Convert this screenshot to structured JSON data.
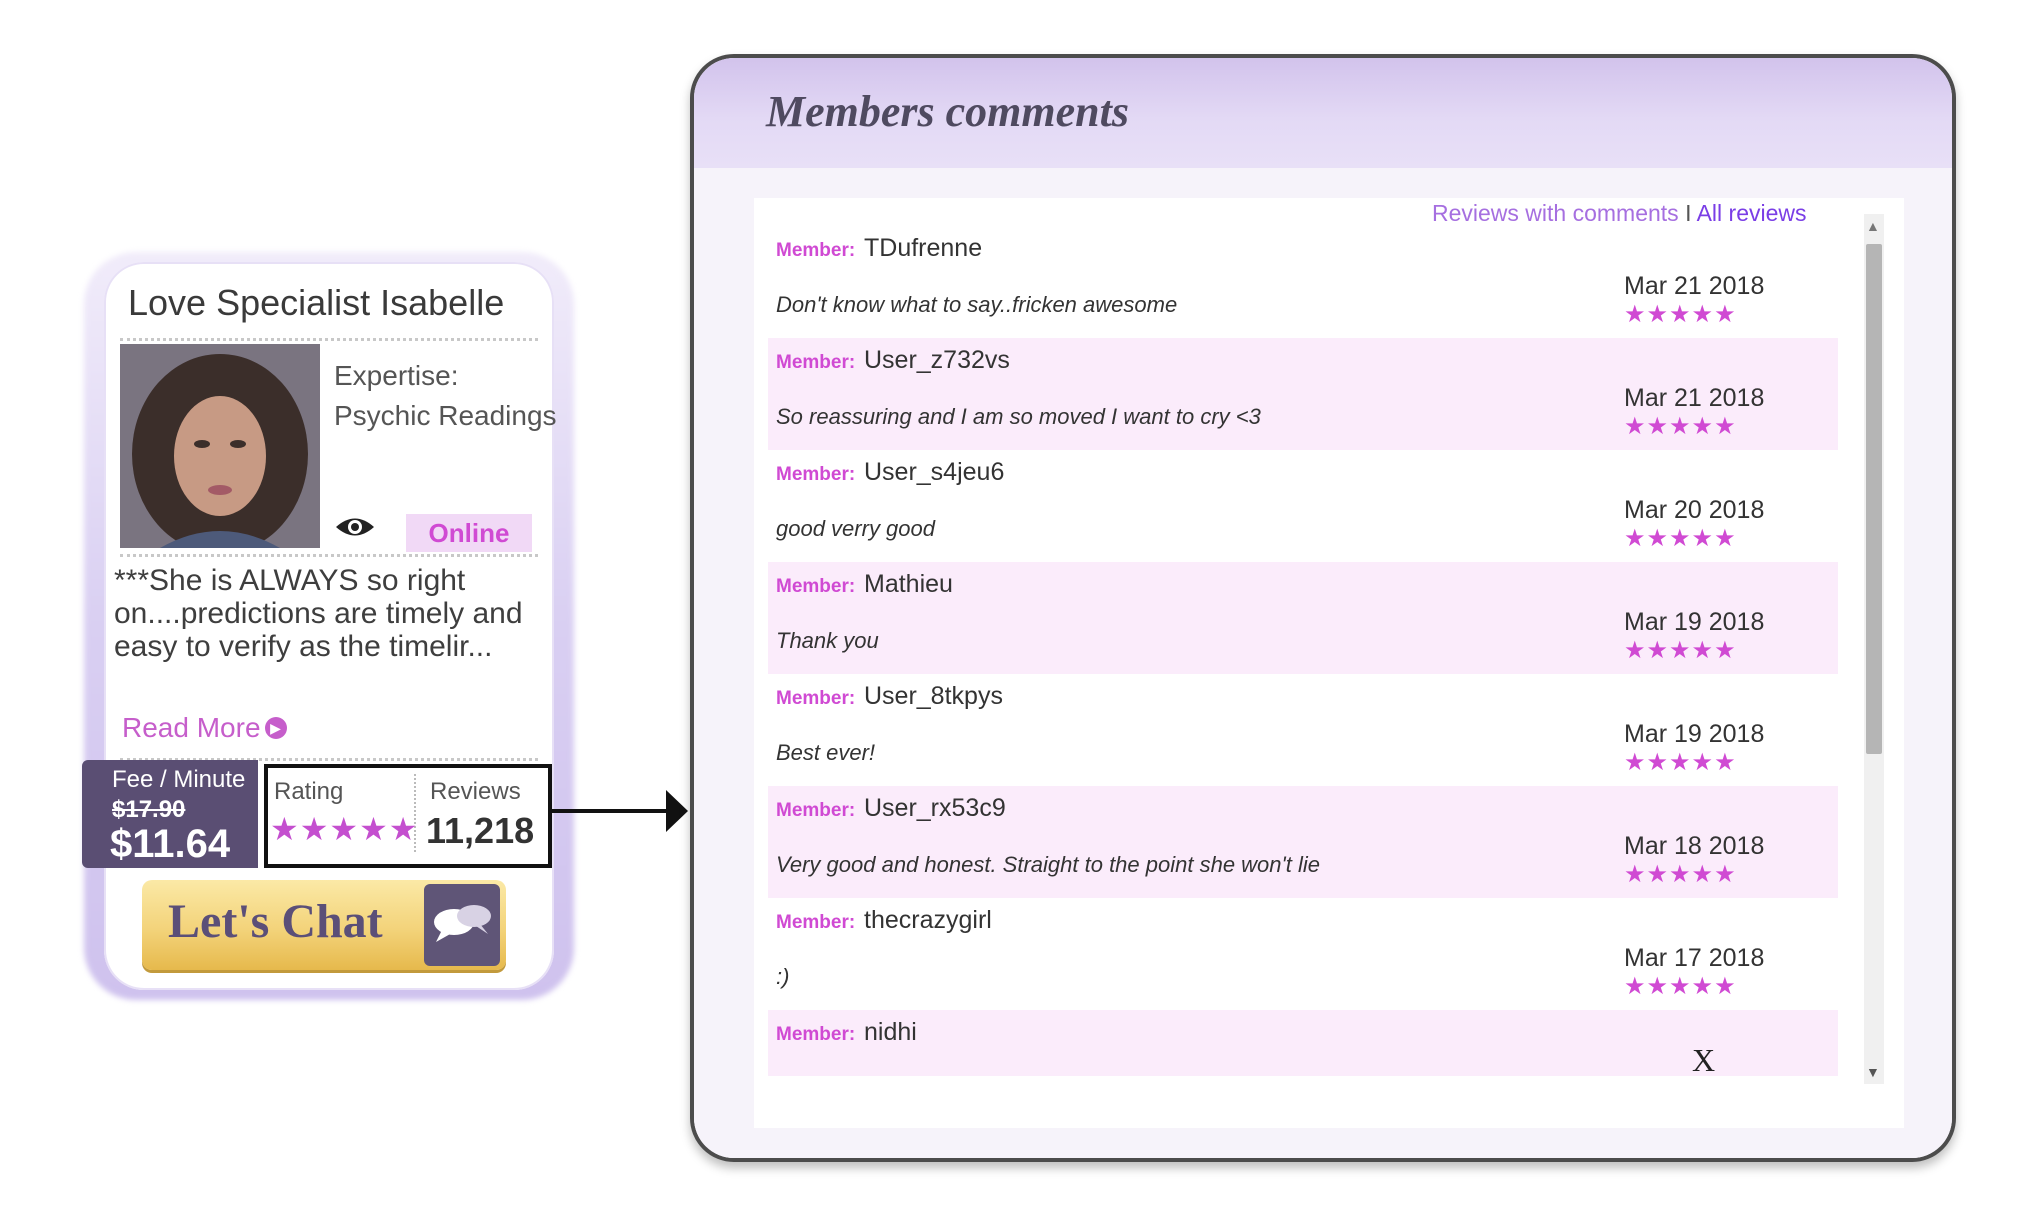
{
  "profile": {
    "name": "Love Specialist Isabelle",
    "expertise_label": "Expertise:",
    "expertise_value": "Psychic Readings",
    "status": "Online",
    "bio": "***She is ALWAYS so right on....predictions are timely and easy to verify as the timelir...",
    "read_more": "Read More",
    "fee_label": "Fee / Minute",
    "fee_old": "$17.90",
    "fee_new": "$11.64",
    "rating_label": "Rating",
    "rating_stars": "★★★★★",
    "reviews_label": "Reviews",
    "reviews_count": "11,218",
    "chat_label": "Let's Chat"
  },
  "panel": {
    "title": "Members comments",
    "link_with_comments": "Reviews with comments",
    "link_separator": " I ",
    "link_all": "All reviews",
    "member_label": "Member:",
    "close": "X"
  },
  "comments": [
    {
      "member": "TDufrenne",
      "text": "Don't know what to say..fricken awesome",
      "date": "Mar 21 2018",
      "stars": "★★★★★"
    },
    {
      "member": "User_z732vs",
      "text": "So reassuring and I am so moved I want to cry <3",
      "date": "Mar 21 2018",
      "stars": "★★★★★"
    },
    {
      "member": "User_s4jeu6",
      "text": "good verry good",
      "date": "Mar 20 2018",
      "stars": "★★★★★"
    },
    {
      "member": "Mathieu",
      "text": "Thank you",
      "date": "Mar 19 2018",
      "stars": "★★★★★"
    },
    {
      "member": "User_8tkpys",
      "text": "Best ever!",
      "date": "Mar 19 2018",
      "stars": "★★★★★"
    },
    {
      "member": "User_rx53c9",
      "text": "Very good and honest. Straight to the point she won't lie",
      "date": "Mar 18 2018",
      "stars": "★★★★★"
    },
    {
      "member": "thecrazygirl",
      "text": ":)",
      "date": "Mar 17 2018",
      "stars": "★★★★★"
    },
    {
      "member": "nidhi",
      "text": "",
      "date": "",
      "stars": ""
    }
  ],
  "colors": {
    "accent": "#d04ad3",
    "header_lavender": "#d2c3ec",
    "fee_box": "#5a4e73",
    "chat_gold": "#f3d37a",
    "row_alt": "#fbecfb"
  }
}
